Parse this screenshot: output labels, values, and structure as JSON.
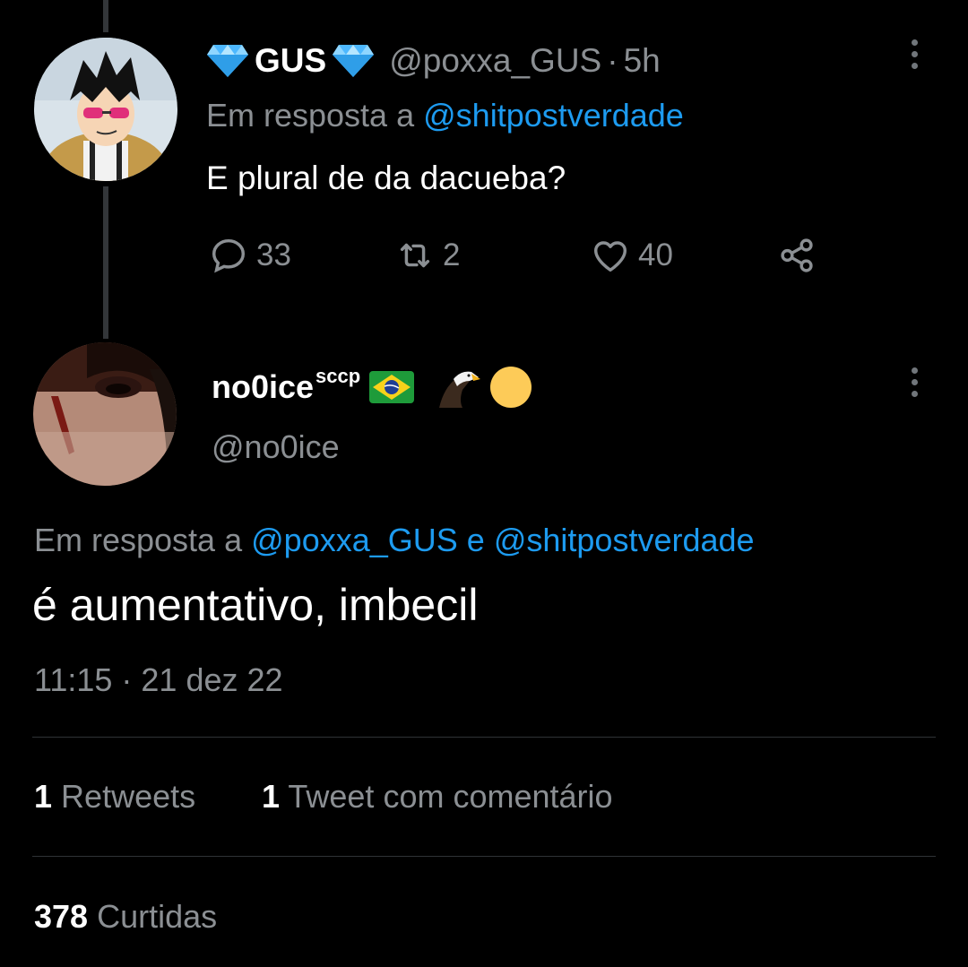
{
  "tweet1": {
    "display_name": "GUS",
    "handle": "@poxxa_GUS",
    "separator": "·",
    "time": "5h",
    "reply_prefix": "Em resposta a",
    "reply_to": "@shitpostverdade",
    "text": "E plural de da dacueba?",
    "stats": {
      "replies": "33",
      "retweets": "2",
      "likes": "40"
    }
  },
  "tweet2": {
    "display_name": "no0ice",
    "name_superscript": "sccp",
    "name_emojis": [
      "🇧🇷",
      "🦅",
      "🟡"
    ],
    "handle": "@no0ice",
    "reply_prefix": "Em resposta a",
    "reply_to_1": "@poxxa_GUS",
    "reply_conjunction": "e",
    "reply_to_2": "@shitpostverdade",
    "text": "é aumentativo, imbecil",
    "timestamp": "11:15 · 21 dez 22",
    "retweets_count": "1",
    "retweets_label": "Retweets",
    "quotes_count": "1",
    "quotes_label": "Tweet com comentário",
    "likes_count": "378",
    "likes_label": "Curtidas"
  },
  "colors": {
    "accent": "#1d9bf0",
    "background": "#000000",
    "muted": "#8b8f93",
    "diamond": "#4db8ff"
  },
  "icons": [
    "diamond-icon",
    "more-icon",
    "reply-icon",
    "retweet-icon",
    "like-icon",
    "share-icon"
  ]
}
